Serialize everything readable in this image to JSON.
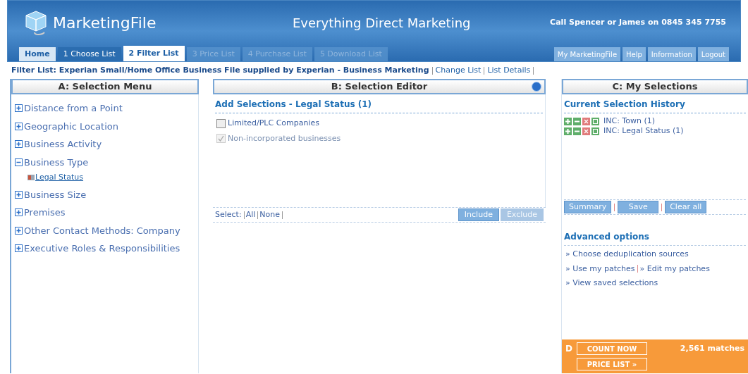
{
  "header": {
    "logo": "MarketingFile",
    "tagline": "Everything Direct Marketing",
    "phone": "Call Spencer or James on 0845 345 7755"
  },
  "tabs": [
    {
      "label": "Home",
      "selected": false,
      "disabled": false
    },
    {
      "label": "1 Choose List",
      "selected": false,
      "disabled": false
    },
    {
      "label": "2 Filter List",
      "selected": true,
      "disabled": false
    },
    {
      "label": "3 Price List",
      "selected": false,
      "disabled": true
    },
    {
      "label": "4 Purchase List",
      "selected": false,
      "disabled": true
    },
    {
      "label": "5 Download List",
      "selected": false,
      "disabled": true
    }
  ],
  "account_tabs": [
    "My MarketingFile",
    "Help",
    "Information",
    "Logout"
  ],
  "filter_line": {
    "text": "Filter List: Experian Small/Home Office Business File supplied by Experian - Business Marketing",
    "links": [
      "Change List",
      "List Details"
    ]
  },
  "selection_menu": {
    "title": "A: Selection Menu",
    "items": [
      {
        "label": "Distance from a Point",
        "expanded": false
      },
      {
        "label": "Geographic Location",
        "expanded": false
      },
      {
        "label": "Business Activity",
        "expanded": false
      },
      {
        "label": "Business Type",
        "expanded": true,
        "children": [
          {
            "label": "Legal Status"
          }
        ]
      },
      {
        "label": "Business Size",
        "expanded": false
      },
      {
        "label": "Premises",
        "expanded": false
      },
      {
        "label": "Other Contact Methods: Company",
        "expanded": false
      },
      {
        "label": "Executive Roles & Responsibilities",
        "expanded": false
      }
    ]
  },
  "selection_editor": {
    "title": "B: Selection Editor",
    "subtitle": "Add Selections - Legal Status (1)",
    "options": [
      {
        "label": "Limited/PLC Companies",
        "checked": false,
        "disabled": false
      },
      {
        "label": "Non-incorporated businesses",
        "checked": true,
        "disabled": true
      }
    ],
    "select_label": "Select:",
    "select_links": [
      "All",
      "None"
    ],
    "buttons": [
      {
        "label": "Include",
        "disabled": false
      },
      {
        "label": "Exclude",
        "disabled": true
      }
    ]
  },
  "my_selections": {
    "title": "C: My Selections",
    "history_title": "Current Selection History",
    "history": [
      "INC: Town (1)",
      "INC: Legal Status (1)"
    ],
    "buttons": [
      "Summary",
      "Save",
      "Clear all"
    ],
    "advanced_title": "Advanced options",
    "advanced_links": [
      [
        "» Choose deduplication sources"
      ],
      [
        "» Use my patches",
        "» Edit my patches"
      ],
      [
        "» View saved selections"
      ]
    ]
  },
  "count_panel": {
    "letter": "D",
    "count_button": "COUNT NOW",
    "matches": "2,561 matches",
    "price_button": "PRICE LIST »"
  }
}
